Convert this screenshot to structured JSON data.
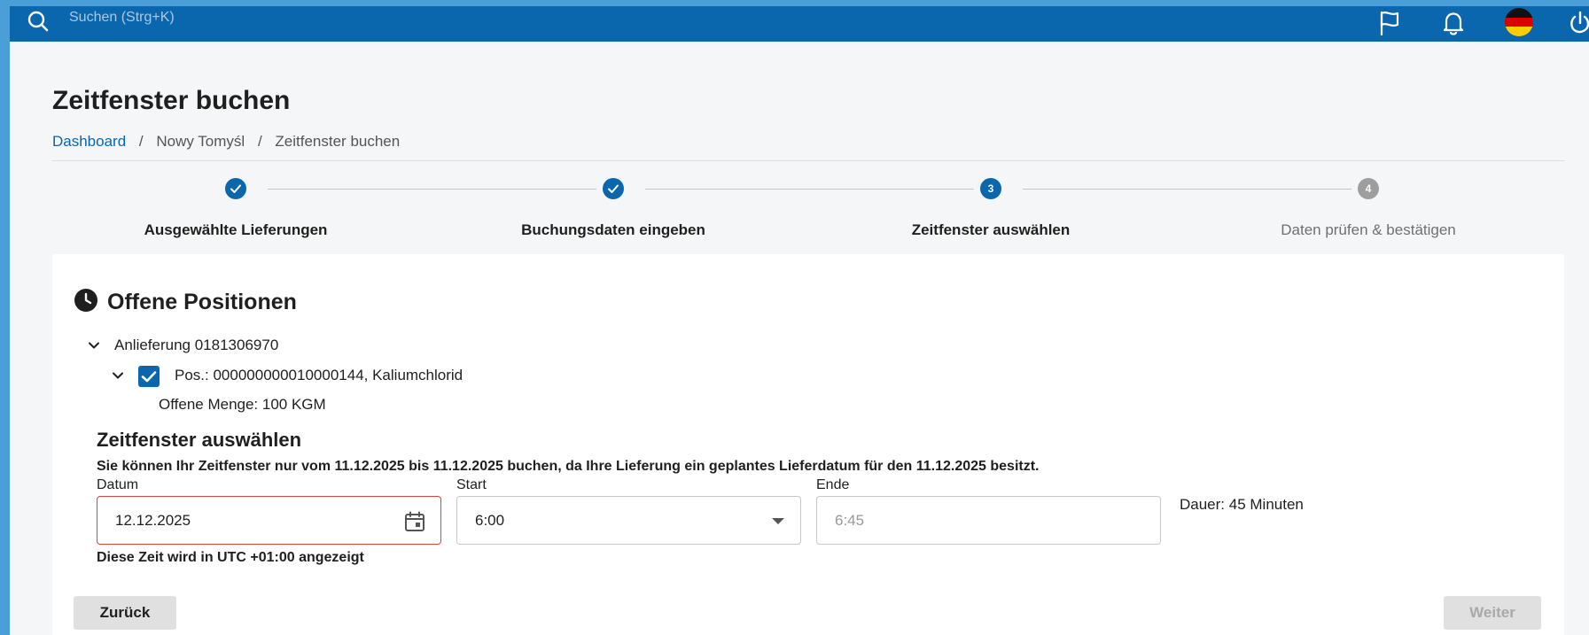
{
  "topbar": {
    "search_placeholder": "Suchen (Strg+K)",
    "icons": [
      "search-icon",
      "flag-icon",
      "bell-icon",
      "german-flag-icon",
      "power-icon"
    ],
    "background": "#0a66ad"
  },
  "page": {
    "title": "Zeitfenster buchen",
    "breadcrumb": [
      "Dashboard",
      "Nowy Tomyśl",
      "Zeitfenster buchen"
    ]
  },
  "stepper": {
    "steps": [
      {
        "number": "1",
        "label": "Ausgewählte Lieferungen",
        "state": "done"
      },
      {
        "number": "2",
        "label": "Buchungsdaten eingeben",
        "state": "done"
      },
      {
        "number": "3",
        "label": "Zeitfenster auswählen",
        "state": "active"
      },
      {
        "number": "4",
        "label": "Daten prüfen & bestätigen",
        "state": "todo"
      }
    ]
  },
  "positions": {
    "title": "Offene Positionen",
    "delivery_label": "Anlieferung 0181306970",
    "position_label": "Pos.: 000000000010000144, Kaliumchlorid",
    "position_checked": true,
    "open_quantity": "Offene Menge: 100 KGM"
  },
  "timeslot": {
    "title": "Zeitfenster auswählen",
    "info": "Sie können Ihr Zeitfenster nur vom 11.12.2025 bis 11.12.2025 buchen, da Ihre Lieferung ein geplantes Lieferdatum für den 11.12.2025 besitzt.",
    "date_label": "Datum",
    "date_value": "12.12.2025",
    "start_label": "Start",
    "start_value": "6:00",
    "end_label": "Ende",
    "end_value": "6:45",
    "duration": "Dauer: 45 Minuten",
    "utc_note": "Diese Zeit wird in UTC +01:00 angezeigt"
  },
  "footer": {
    "back_label": "Zurück",
    "next_label": "Weiter"
  },
  "colors": {
    "accent": "#0a66ad",
    "error": "#d84444",
    "inactive_step": "#9e9e9e"
  }
}
